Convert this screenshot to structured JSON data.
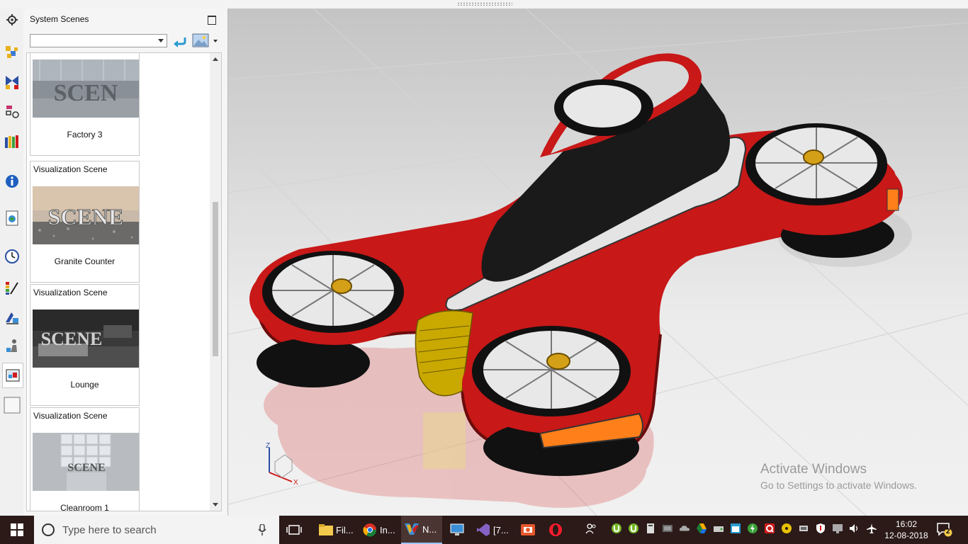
{
  "panel": {
    "title": "System Scenes",
    "combo_value": "",
    "scenes": [
      {
        "type": "",
        "name": "Factory 3",
        "thumb_text": "SCEN"
      },
      {
        "type": "Visualization Scene",
        "name": "Granite Counter",
        "thumb_text": "SCENE"
      },
      {
        "type": "Visualization Scene",
        "name": "Lounge",
        "thumb_text": "SCENE"
      },
      {
        "type": "Visualization Scene",
        "name": "Cleanroom 1",
        "thumb_text": "SCENE"
      }
    ]
  },
  "toolbar_icons": [
    "gear-icon",
    "assembly-navigator-icon",
    "constraint-navigator-icon",
    "part-navigator-icon",
    "library-icon",
    "info-icon",
    "web-browser-icon",
    "history-icon",
    "color-palette-icon",
    "process-studio-icon",
    "roles-icon",
    "system-scenes-icon",
    "blank-icon"
  ],
  "viewport": {
    "axis_labels": {
      "z": "Z",
      "x": "X"
    },
    "watermark_title": "Activate Windows",
    "watermark_sub": "Go to Settings to activate Windows."
  },
  "taskbar": {
    "search_placeholder": "Type here to search",
    "apps": [
      {
        "label": "Fil...",
        "icon": "file-explorer-icon"
      },
      {
        "label": "In...",
        "icon": "chrome-icon"
      },
      {
        "label": "N...",
        "icon": "nx-icon"
      },
      {
        "label": "",
        "icon": "computer-icon"
      },
      {
        "label": "[7...",
        "icon": "visual-studio-icon"
      },
      {
        "label": "",
        "icon": "media-icon"
      },
      {
        "label": "",
        "icon": "opera-icon"
      }
    ],
    "clock_time": "16:02",
    "clock_date": "12-08-2018",
    "notification_count": "2"
  },
  "colors": {
    "accent_red": "#d11b1b",
    "taskbar": "#2b1a18",
    "viewport_bg": "#e6e6e6"
  }
}
